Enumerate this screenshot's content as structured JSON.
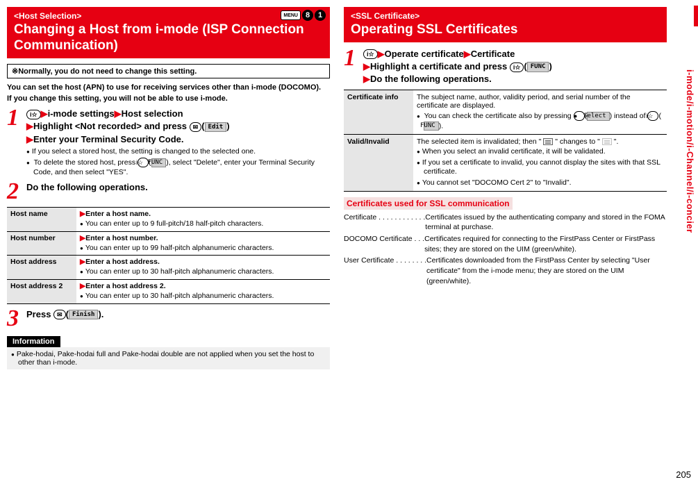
{
  "sideTab": "i-mode/i-motion/i-Channel/i-concier",
  "pageNumber": "205",
  "left": {
    "bracket": "<Host Selection>",
    "title": "Changing a Host from i-mode (ISP Connection Communication)",
    "menuKeys": {
      "menu": "MENU",
      "d1": "8",
      "d2": "1"
    },
    "noteBox": "※Normally, you do not need to change this setting.",
    "intro1": "You can set the host (APN) to use for receiving services other than i-mode (DOCOMO).",
    "intro2": "If you change this setting, you will not be able to use i-mode.",
    "step1": {
      "l1a": "i-mode settings",
      "l1b": "Host selection",
      "l2a": "Highlight <Not recorded> and press ",
      "l2b_soft": "Edit",
      "l3": "Enter your Terminal Security Code.",
      "b1": "If you select a stored host, the setting is changed to the selected one.",
      "b2a": "To delete the stored host, press ",
      "b2b_soft": "FUNC",
      "b2c": ", select \"Delete\", enter your Terminal Security Code, and then select \"YES\"."
    },
    "step2": {
      "title": "Do the following operations."
    },
    "table": {
      "r1": {
        "label": "Host name",
        "desc": "Enter a host name.",
        "note": "You can enter up to 9 full-pitch/18 half-pitch characters."
      },
      "r2": {
        "label": "Host number",
        "desc": "Enter a host number.",
        "note": "You can enter up to 99 half-pitch alphanumeric characters."
      },
      "r3": {
        "label": "Host address",
        "desc": "Enter a host address.",
        "note": "You can enter up to 30 half-pitch alphanumeric characters."
      },
      "r4": {
        "label": "Host address 2",
        "desc": "Enter a host address 2.",
        "note": "You can enter up to 30 half-pitch alphanumeric characters."
      }
    },
    "step3": {
      "pre": "Press ",
      "soft": "Finish",
      "post": "."
    },
    "infoHeader": "Information",
    "infoBullet": "Pake-hodai, Pake-hodai full and Pake-hodai double are not applied when you set the host to other than i-mode."
  },
  "right": {
    "bracket": "<SSL Certificate>",
    "title": "Operating SSL Certificates",
    "step1": {
      "l1a": "Operate certificate",
      "l1b": "Certificate",
      "l2a": "Highlight a certificate and press ",
      "l2_soft": "FUNC",
      "l3": "Do the following operations."
    },
    "certTable": {
      "r1": {
        "label": "Certificate info",
        "desc": "The subject name, author, validity period, and serial number of the certificate are displayed.",
        "b1a": "You can check the certificate also by pressing ",
        "b1_soft1": "Select",
        "b1b": " instead of ",
        "b1_soft2": "FUNC",
        "b1c": "."
      },
      "r2": {
        "label": "Valid/Invalid",
        "desc_a": "The selected item is invalidated; then \" ",
        "desc_b": " \" changes to \" ",
        "desc_c": " \".",
        "b1": "When you select an invalid certificate, it will be validated.",
        "b2": "If you set a certificate to invalid, you cannot display the sites with that SSL certificate.",
        "b3": "You cannot set \"DOCOMO Cert 2\" to \"Invalid\"."
      }
    },
    "sectionTitle": "Certificates used for SSL communication",
    "certs": {
      "c1": {
        "label": "Certificate  . . . . . . . . . . . . ",
        "desc": "Certificates issued by the authenticating company and stored in the FOMA terminal at purchase."
      },
      "c2": {
        "label": "DOCOMO Certificate  . . . ",
        "desc": "Certificates required for connecting to the FirstPass Center or FirstPass sites; they are stored on the UIM (green/white)."
      },
      "c3": {
        "label": "User Certificate . . . . . . . . ",
        "desc": "Certificates downloaded from the FirstPass Center by selecting \"User certificate\" from the i-mode menu; they are stored on the UIM (green/white)."
      }
    }
  }
}
